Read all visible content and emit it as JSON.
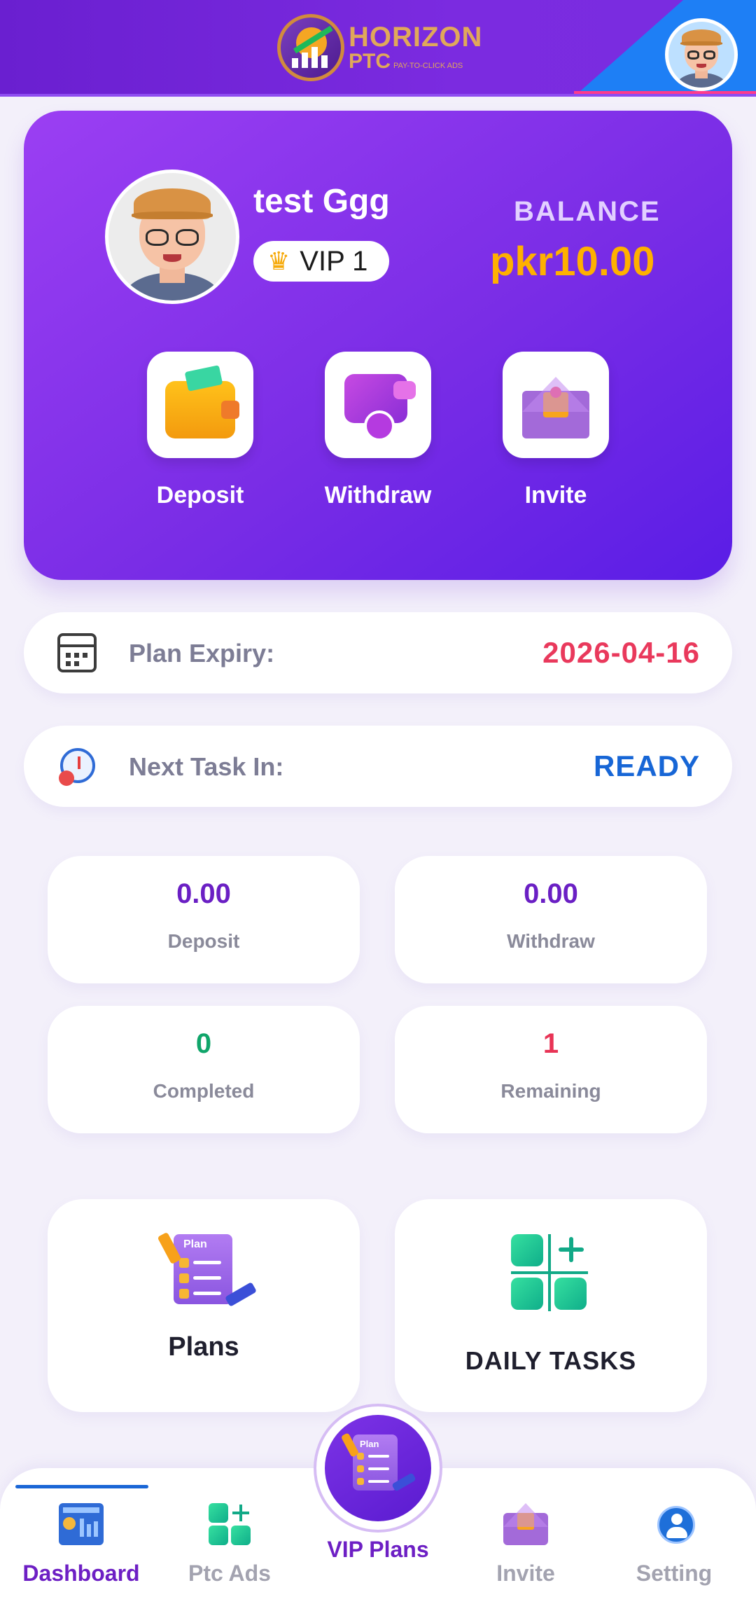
{
  "header": {
    "logo_line1": "HORIZON",
    "logo_line2": "PTC",
    "logo_tagline": "PAY-TO-CLICK ADS"
  },
  "profile": {
    "username": "test Ggg",
    "vip_label": "VIP 1",
    "balance_label": "BALANCE",
    "balance_value": "pkr10.00"
  },
  "actions": [
    {
      "label": "Deposit",
      "icon": "wallet-icon"
    },
    {
      "label": "Withdraw",
      "icon": "withdraw-icon"
    },
    {
      "label": "Invite",
      "icon": "invite-envelope-icon"
    }
  ],
  "info": {
    "plan_expiry_label": "Plan Expiry:",
    "plan_expiry_value": "2026-04-16",
    "next_task_label": "Next Task In:",
    "next_task_value": "READY"
  },
  "stats": [
    {
      "value": "0.00",
      "label": "Deposit"
    },
    {
      "value": "0.00",
      "label": "Withdraw"
    },
    {
      "value": "0",
      "label": "Completed"
    },
    {
      "value": "1",
      "label": "Remaining"
    }
  ],
  "features": {
    "plans_label": "Plans",
    "plans_icon_text": "Plan",
    "daily_tasks_label": "DAILY TASKS"
  },
  "nav": {
    "dashboard": "Dashboard",
    "ptc_ads": "Ptc Ads",
    "vip_plans": "VIP Plans",
    "invite": "Invite",
    "setting": "Setting",
    "active": "Dashboard"
  },
  "colors": {
    "primary_purple": "#7a2de6",
    "balance_gold": "#ffb000",
    "expiry_red": "#e9395c",
    "ready_blue": "#1766d6",
    "completed_green": "#10a56a",
    "remaining_red": "#e83355"
  }
}
